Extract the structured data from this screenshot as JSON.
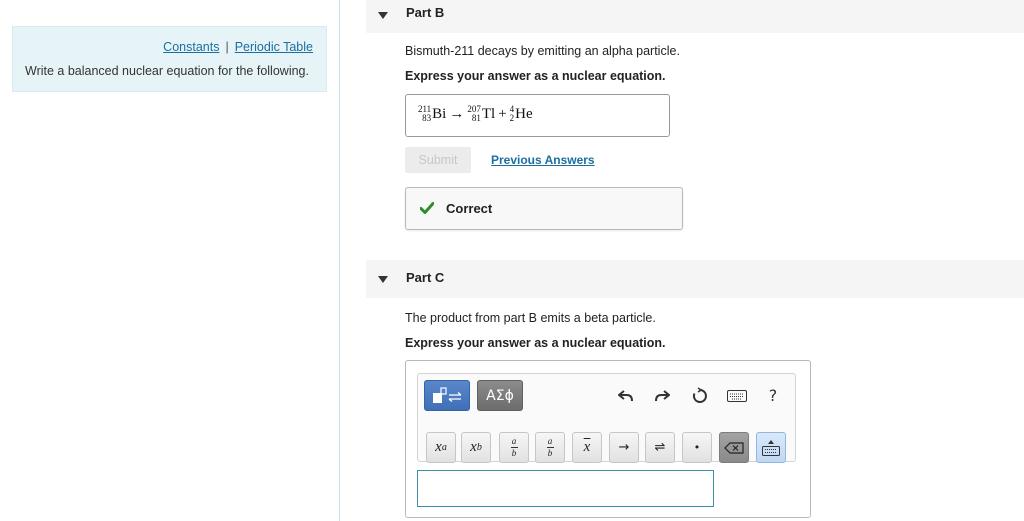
{
  "sidebar": {
    "links": [
      "Constants",
      "Periodic Table"
    ],
    "separator": "|",
    "instruction": "Write a balanced nuclear equation for the following."
  },
  "partB": {
    "title": "Part B",
    "prompt": "Bismuth-211 decays by emitting an alpha particle.",
    "instruction": "Express your answer as a nuclear equation.",
    "equation": {
      "reactant": {
        "mass": "211",
        "atomic": "83",
        "symbol": "Bi"
      },
      "arrow": "→",
      "product1": {
        "mass": "207",
        "atomic": "81",
        "symbol": "Tl"
      },
      "plus": "+",
      "product2": {
        "mass": "4",
        "atomic": "2",
        "symbol": "He"
      }
    },
    "submit_label": "Submit",
    "previous_answers_label": "Previous Answers",
    "status": "Correct",
    "status_color": "#2e8b2e"
  },
  "partC": {
    "title": "Part C",
    "prompt": "The product from part B emits a beta particle.",
    "instruction": "Express your answer as a nuclear equation.",
    "greek_label": "ΑΣϕ",
    "toolbar_icons": [
      "undo-icon",
      "redo-icon",
      "reset-icon",
      "keyboard-icon",
      "help-icon"
    ],
    "help_label": "?",
    "keys": {
      "superscript_base": "x",
      "superscript_exp": "a",
      "subscript_base": "x",
      "subscript_sub": "b",
      "frac_num": "a",
      "frac_den": "b",
      "frac2_num": "a",
      "frac2_den": "b",
      "vector": "x",
      "arrow": "→",
      "equilibrium": "⇌",
      "dot": "•"
    },
    "answer_value": ""
  },
  "colors": {
    "link": "#1a6fa0",
    "template_button": "#4a7cc2",
    "info_box": "#e6f4f7",
    "input_border": "#3b8fa8"
  }
}
